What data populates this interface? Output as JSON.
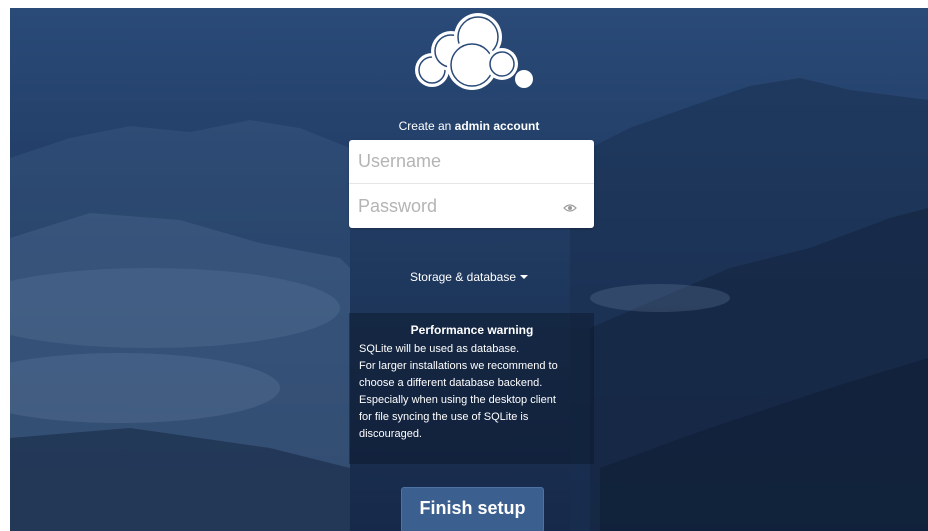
{
  "caption": {
    "prefix": "Create an",
    "emphasis": "admin account"
  },
  "login": {
    "username_placeholder": "Username",
    "password_placeholder": "Password",
    "password_toggle_icon": "eye-icon"
  },
  "storage": {
    "label": "Storage & database",
    "icon": "caret-down-icon"
  },
  "warning": {
    "title": "Performance warning",
    "lines": [
      "SQLite will be used as database.",
      "For larger installations we recommend to",
      "choose a different database backend.",
      "Especially when using the desktop client",
      "for file syncing the use of SQLite is",
      "discouraged."
    ]
  },
  "finish": {
    "label": "Finish setup"
  },
  "colors": {
    "background": "#233f68",
    "button": "#3b5f8f",
    "text": "#ffffff"
  }
}
